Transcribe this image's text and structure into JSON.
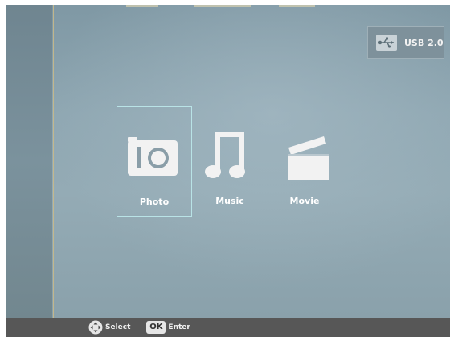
{
  "device": {
    "label": "USB 2.0",
    "icon": "usb-icon"
  },
  "menu": {
    "items": [
      {
        "label": "Photo",
        "icon": "camera-icon",
        "selected": true
      },
      {
        "label": "Music",
        "icon": "music-note-icon",
        "selected": false
      },
      {
        "label": "Movie",
        "icon": "clapperboard-icon",
        "selected": false
      }
    ]
  },
  "footer": {
    "select_label": "Select",
    "ok_key": "OK",
    "enter_label": "Enter"
  },
  "colors": {
    "background": "#8fa7b2",
    "selection_border": "#b9e3e6",
    "icon": "#f2f2f2",
    "footer": "#575757"
  }
}
